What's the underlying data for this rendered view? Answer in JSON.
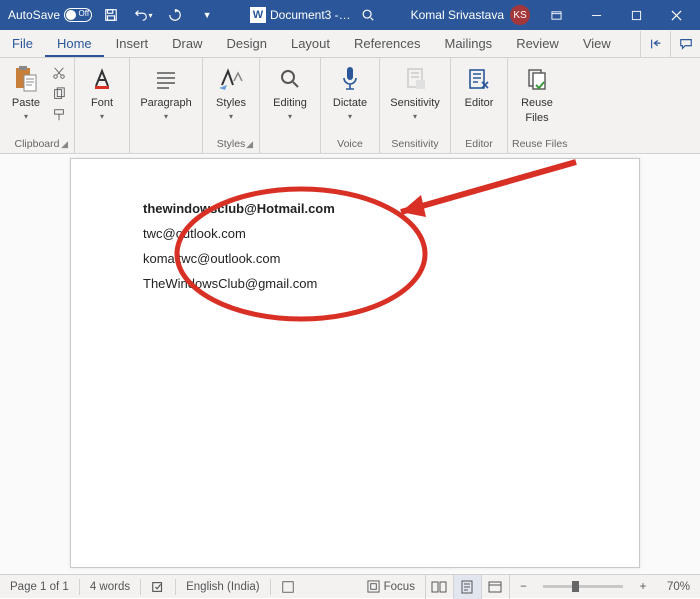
{
  "titlebar": {
    "autosave_label": "AutoSave",
    "autosave_state": "Off",
    "doc_name": "Document3 -…",
    "user_name": "Komal Srivastava",
    "user_initials": "KS"
  },
  "tabs": {
    "file": "File",
    "items": [
      "Home",
      "Insert",
      "Draw",
      "Design",
      "Layout",
      "References",
      "Mailings",
      "Review",
      "View"
    ],
    "active": "Home"
  },
  "ribbon": {
    "clipboard": {
      "paste": "Paste",
      "label": "Clipboard"
    },
    "font": {
      "btn": "Font",
      "label": ""
    },
    "paragraph": {
      "btn": "Paragraph",
      "label": ""
    },
    "styles": {
      "btn": "Styles",
      "label": "Styles"
    },
    "editing": {
      "btn": "Editing",
      "label": ""
    },
    "voice": {
      "btn": "Dictate",
      "label": "Voice"
    },
    "sensitivity": {
      "btn": "Sensitivity",
      "label": "Sensitivity"
    },
    "editor": {
      "btn": "Editor",
      "label": "Editor"
    },
    "reuse": {
      "btn_l1": "Reuse",
      "btn_l2": "Files",
      "label": "Reuse Files"
    }
  },
  "document": {
    "lines": [
      {
        "text": "thewindowsclub@Hotmail.com",
        "bold": true
      },
      {
        "text": "twc@outlook.com",
        "bold": false
      },
      {
        "text": "komaltwc@outlook.com",
        "bold": false
      },
      {
        "text": "TheWindowsClub@gmail.com",
        "bold": false
      }
    ]
  },
  "statusbar": {
    "page": "Page 1 of 1",
    "words": "4 words",
    "language": "English (India)",
    "focus": "Focus",
    "zoom": "70%"
  },
  "colors": {
    "brand": "#2b579a",
    "annotation": "#d93025"
  }
}
